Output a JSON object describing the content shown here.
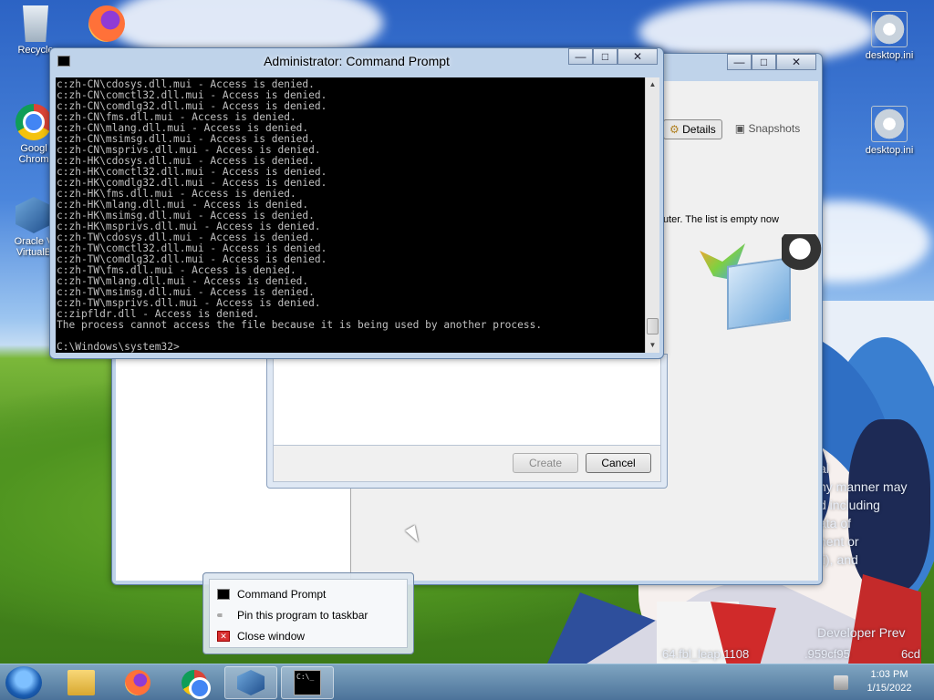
{
  "desktop": {
    "icons": [
      {
        "label": "Recycle",
        "icon": "recycle-bin-icon"
      },
      {
        "label": "",
        "icon": "firefox-icon"
      },
      {
        "label": "Googl Chrom",
        "icon": "chrome-icon"
      },
      {
        "label": "Oracle V VirtualB",
        "icon": "virtualbox-icon"
      },
      {
        "label": "desktop.ini",
        "icon": "settings-file-icon"
      },
      {
        "label": "desktop.ini",
        "icon": "settings-file-icon"
      }
    ],
    "wallpaper_text": [
      "al",
      "ny manner may",
      "d including",
      "ata of",
      "nent or",
      "ti), and",
      "Developer Prev",
      "64.fbl_leap.1108",
      ".959cf95",
      "6cd"
    ]
  },
  "cmd": {
    "title": "Administrator: Command Prompt",
    "lines": [
      "c:zh-CN\\cdosys.dll.mui - Access is denied.",
      "c:zh-CN\\comctl32.dll.mui - Access is denied.",
      "c:zh-CN\\comdlg32.dll.mui - Access is denied.",
      "c:zh-CN\\fms.dll.mui - Access is denied.",
      "c:zh-CN\\mlang.dll.mui - Access is denied.",
      "c:zh-CN\\msimsg.dll.mui - Access is denied.",
      "c:zh-CN\\msprivs.dll.mui - Access is denied.",
      "c:zh-HK\\cdosys.dll.mui - Access is denied.",
      "c:zh-HK\\comctl32.dll.mui - Access is denied.",
      "c:zh-HK\\comdlg32.dll.mui - Access is denied.",
      "c:zh-HK\\fms.dll.mui - Access is denied.",
      "c:zh-HK\\mlang.dll.mui - Access is denied.",
      "c:zh-HK\\msimsg.dll.mui - Access is denied.",
      "c:zh-HK\\msprivs.dll.mui - Access is denied.",
      "c:zh-TW\\cdosys.dll.mui - Access is denied.",
      "c:zh-TW\\comctl32.dll.mui - Access is denied.",
      "c:zh-TW\\comdlg32.dll.mui - Access is denied.",
      "c:zh-TW\\fms.dll.mui - Access is denied.",
      "c:zh-TW\\mlang.dll.mui - Access is denied.",
      "c:zh-TW\\msimsg.dll.mui - Access is denied.",
      "c:zh-TW\\msprivs.dll.mui - Access is denied.",
      "c:zipfldr.dll - Access is denied.",
      "The process cannot access the file because it is being used by another process.",
      "",
      "C:\\Windows\\system32>"
    ]
  },
  "virtualbox": {
    "toolbar": {
      "details": "Details",
      "snapshots": "Snapshots"
    },
    "empty_message": "uter. The list is empty now",
    "dialog": {
      "create": "Create",
      "cancel": "Cancel"
    }
  },
  "jumplist": {
    "items": [
      {
        "label": "Command Prompt",
        "icon": "cmd-icon"
      },
      {
        "label": "Pin this program to taskbar",
        "icon": "pin-icon"
      },
      {
        "label": "Close window",
        "icon": "close-window-icon"
      }
    ]
  },
  "taskbar": {
    "apps": [
      "windows-explorer",
      "firefox",
      "chrome",
      "virtualbox",
      "command-prompt"
    ],
    "clock": {
      "time": "1:03 PM",
      "date": "1/15/2022"
    }
  }
}
